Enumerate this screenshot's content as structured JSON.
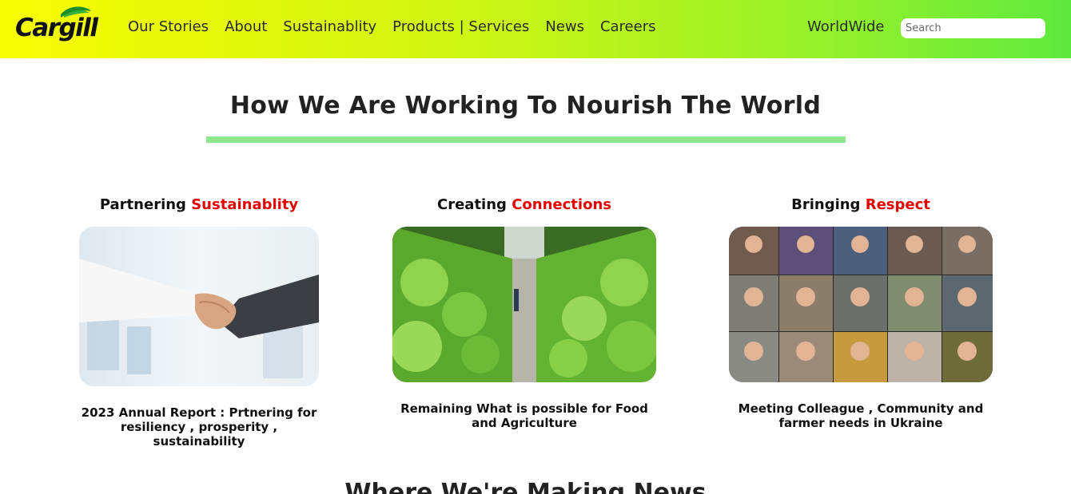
{
  "header": {
    "logo_text": "Cargill",
    "nav": [
      "Our Stories",
      "About",
      "Sustainablity",
      "Products | Services",
      "News",
      "Careers"
    ],
    "worldwide": "WorldWide",
    "search_placeholder": "Search",
    "colors": {
      "gradient_start": "#f7fb00",
      "gradient_end": "#5fe83f"
    }
  },
  "main": {
    "title": "How We Are Working To Nourish The World",
    "accent_bar_color": "#8ee78b",
    "cards": [
      {
        "heading_plain": "Partnering",
        "heading_accent": "Sustainablity",
        "image": "handshake-photo",
        "caption": "2023 Annual Report : Prtnering for resiliency , prosperity , sustainability"
      },
      {
        "heading_plain": "Creating",
        "heading_accent": "Connections",
        "image": "vertical-farm-photo",
        "caption": "Remaining What is possible for Food and Agriculture"
      },
      {
        "heading_plain": "Bringing",
        "heading_accent": "Respect",
        "image": "video-call-hearts-photo",
        "caption": "Meeting Colleague , Community and farmer needs in Ukraine"
      }
    ],
    "accent_color": "#e60000"
  },
  "next_section": {
    "title": "Where We're Making News"
  }
}
